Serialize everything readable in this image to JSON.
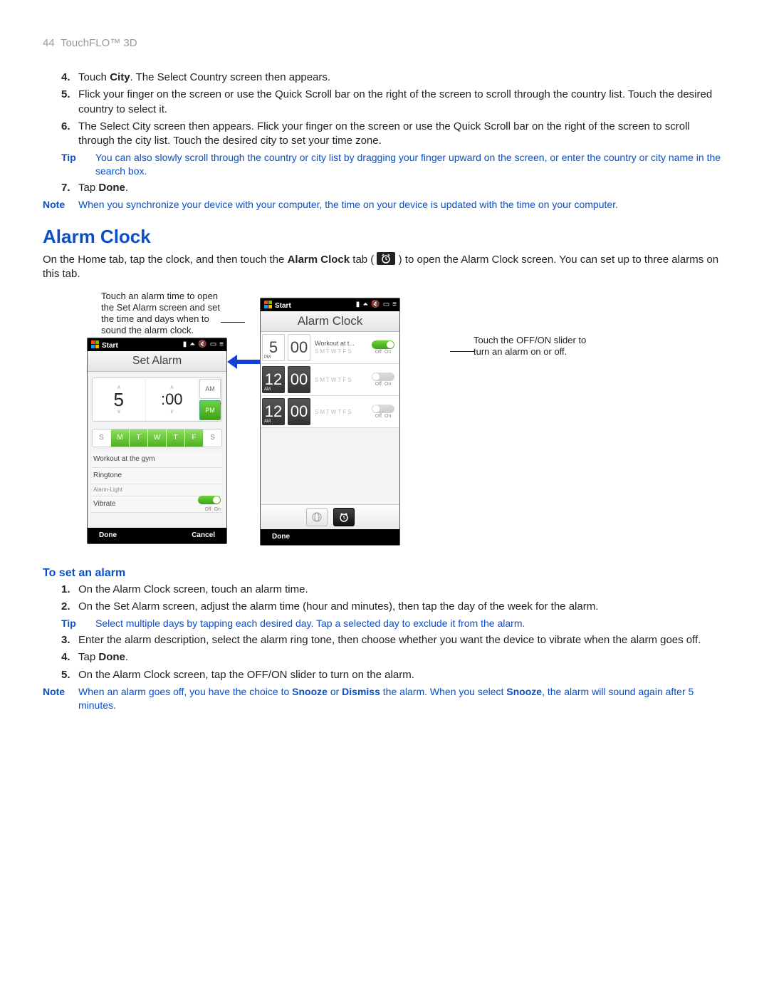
{
  "header": {
    "page_number": "44",
    "section": "TouchFLO™ 3D"
  },
  "pre_steps": [
    {
      "num": "4.",
      "html": "Touch <b>City</b>. The Select Country screen then appears."
    },
    {
      "num": "5.",
      "html": "Flick your finger on the screen or use the Quick Scroll bar on the right of the screen to scroll through the country list. Touch the desired country to select it."
    },
    {
      "num": "6.",
      "html": "The Select City screen then appears. Flick your finger on the screen or use the Quick Scroll bar on the right of the screen to scroll through the city list. Touch the desired city to set your time zone."
    }
  ],
  "tip1": {
    "label": "Tip",
    "text": "You can also slowly scroll through the country or city list by dragging your finger upward on the screen, or enter the country or city name in the search box."
  },
  "step7": {
    "num": "7.",
    "html": "Tap <b>Done</b>."
  },
  "note1": {
    "label": "Note",
    "text": "When you synchronize your device with your computer, the time on your device is updated with the time on your computer."
  },
  "alarm": {
    "heading": "Alarm Clock",
    "intro_prefix": "On the Home tab, tap the clock, and then touch the ",
    "intro_boldtab": "Alarm Clock",
    "intro_tabword": " tab ( ",
    "intro_close": " ) to open the Alarm Clock screen. You can set up to three alarms on this tab.",
    "callout_left": "Touch an alarm time to open the Set Alarm screen and set the time and days when to sound the alarm clock.",
    "callout_right": "Touch the OFF/ON slider to turn an alarm on or off.",
    "set_alarm_screen": {
      "start": "Start",
      "title": "Set Alarm",
      "hour": "5",
      "min": ":00",
      "am": "AM",
      "pm": "PM",
      "days": [
        "S",
        "M",
        "T",
        "W",
        "T",
        "F",
        "S"
      ],
      "selected_days": [
        1,
        2,
        3,
        4,
        5
      ],
      "desc": "Workout at the gym",
      "opts": {
        "ringtone": "Ringtone",
        "light": "Alarm-Light",
        "vibrate": "Vibrate"
      },
      "offon": {
        "off": "Off",
        "on": "On"
      },
      "done": "Done",
      "cancel": "Cancel"
    },
    "alarm_clock_screen": {
      "start": "Start",
      "title": "Alarm Clock",
      "rows": [
        {
          "hour": "5",
          "min": "00",
          "meridiem": "PM",
          "title": "Workout at t...",
          "on": true
        },
        {
          "hour": "12",
          "min": "00",
          "meridiem": "AM",
          "title": "",
          "on": false
        },
        {
          "hour": "12",
          "min": "00",
          "meridiem": "AM",
          "title": "",
          "on": false
        }
      ],
      "daylets": [
        "S",
        "M",
        "T",
        "W",
        "T",
        "F",
        "S"
      ],
      "offon": {
        "off": "Off",
        "on": "On"
      },
      "done": "Done"
    }
  },
  "set_alarm_sub": "To set an alarm",
  "post_steps": [
    {
      "num": "1.",
      "html": "On the Alarm Clock screen, touch an alarm time."
    },
    {
      "num": "2.",
      "html": "On the Set Alarm screen, adjust the alarm time (hour and minutes), then tap the day of the week for the alarm."
    }
  ],
  "tip2": {
    "label": "Tip",
    "text": "Select multiple days by tapping each desired day. Tap a selected day to exclude it from the alarm."
  },
  "post_steps2": [
    {
      "num": "3.",
      "html": "Enter the alarm description, select the alarm ring tone, then choose whether you want the device to vibrate when the alarm goes off."
    },
    {
      "num": "4.",
      "html": "Tap <b>Done</b>."
    },
    {
      "num": "5.",
      "html": "On the Alarm Clock screen, tap the OFF/ON slider to turn on the alarm."
    }
  ],
  "note2": {
    "label": "Note",
    "html": "When an alarm goes off, you have the choice to <b>Snooze</b> or <b>Dismiss</b> the alarm. When you select <b>Snooze</b>, the alarm will sound again after 5 minutes."
  }
}
